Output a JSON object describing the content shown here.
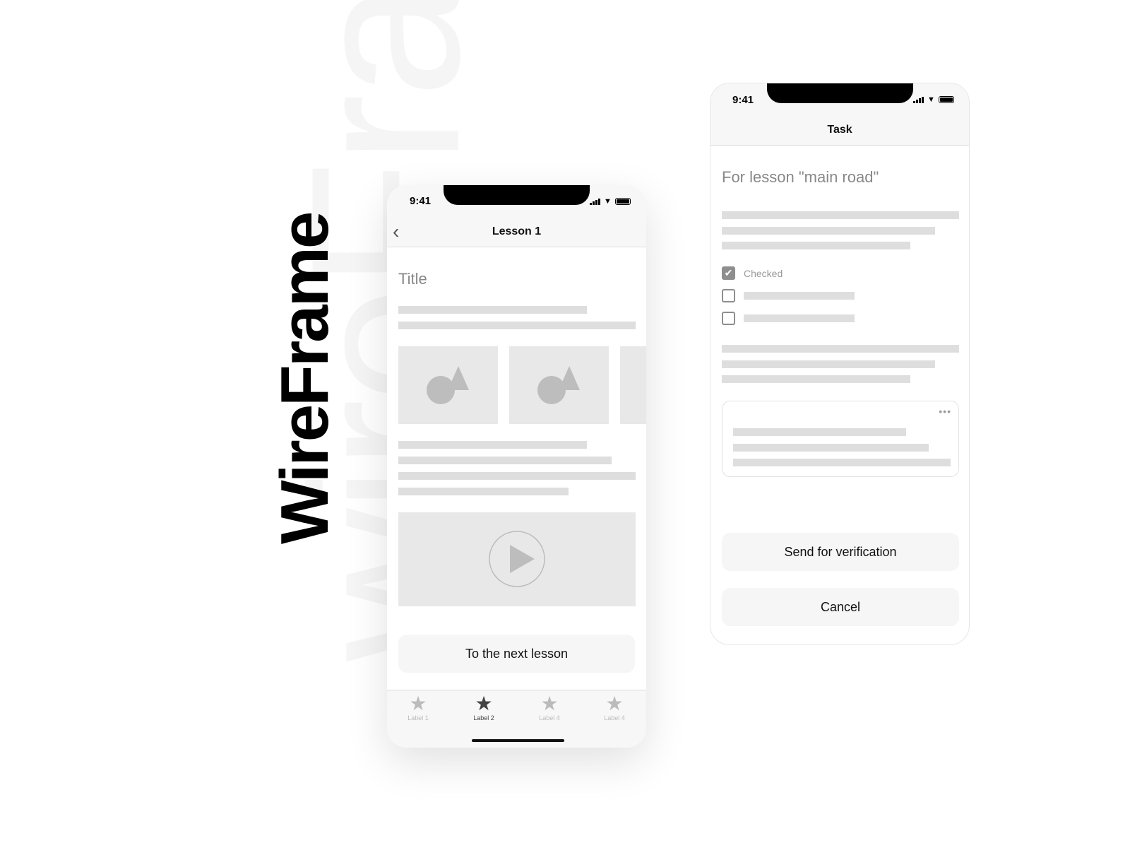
{
  "background_word": "wireFram",
  "title": "WireFrame",
  "phone_lesson": {
    "status_time": "9:41",
    "nav_title": "Lesson 1",
    "content_title": "Title",
    "next_button": "To the next lesson",
    "tabs": [
      {
        "label": "Label 1",
        "active": false
      },
      {
        "label": "Label 2",
        "active": true
      },
      {
        "label": "Label 4",
        "active": false
      },
      {
        "label": "Label 4",
        "active": false
      }
    ]
  },
  "phone_task": {
    "status_time": "9:41",
    "nav_title": "Task",
    "heading": "For lesson \"main road\"",
    "checkbox_checked_label": "Checked",
    "send_button": "Send for verification",
    "cancel_button": "Cancel"
  },
  "colors": {
    "placeholder": "#dedede",
    "active_tab": "#444444",
    "inactive_tab": "#bbbbbb"
  }
}
